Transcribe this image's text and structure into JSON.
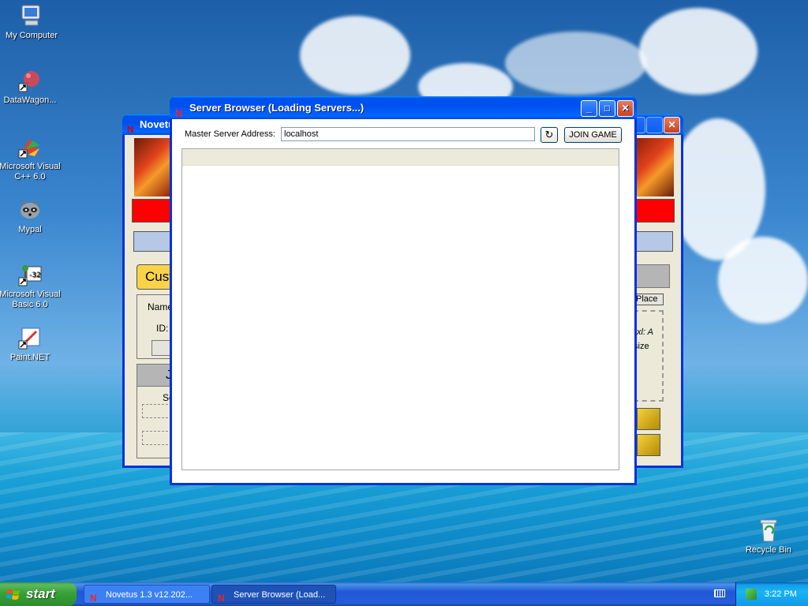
{
  "desktop": {
    "icons": [
      {
        "label": "My Computer",
        "icon": "computer-icon"
      },
      {
        "label": "DataWagon...",
        "icon": "shortcut-icon"
      },
      {
        "label": "Microsoft Visual C++ 6.0",
        "icon": "visual-cpp-icon"
      },
      {
        "label": "Mypal",
        "icon": "raccoon-icon"
      },
      {
        "label": "Microsoft Visual Basic 6.0",
        "icon": "visual-basic-icon"
      },
      {
        "label": "Paint.NET",
        "icon": "paint-icon"
      },
      {
        "label": "Recycle Bin",
        "icon": "recycle-bin-icon"
      }
    ]
  },
  "back_window": {
    "title": "Novetus",
    "fragments": {
      "cust": "Cust",
      "name": "Name",
      "id": "ID:",
      "place": "Place",
      "xl": "xl: A",
      "size": "size",
      "se": "Se",
      "j": "J"
    }
  },
  "window": {
    "title": "Server Browser (Loading Servers...)",
    "minimize_label": "_",
    "maximize_label": "□",
    "close_label": "✕",
    "address_label": "Master Server Address:",
    "address_value": "localhost",
    "join_label": "JOIN GAME",
    "refresh_symbol": "↻"
  },
  "taskbar": {
    "start_label": "start",
    "tasks": [
      {
        "label": "Novetus 1.3 v12.202..."
      },
      {
        "label": "Server Browser (Load..."
      }
    ],
    "clock": "3:22 PM"
  },
  "colors": {
    "titlebar": "#0053ee",
    "close": "#c7411f",
    "window_bg": "#ece9d8"
  }
}
